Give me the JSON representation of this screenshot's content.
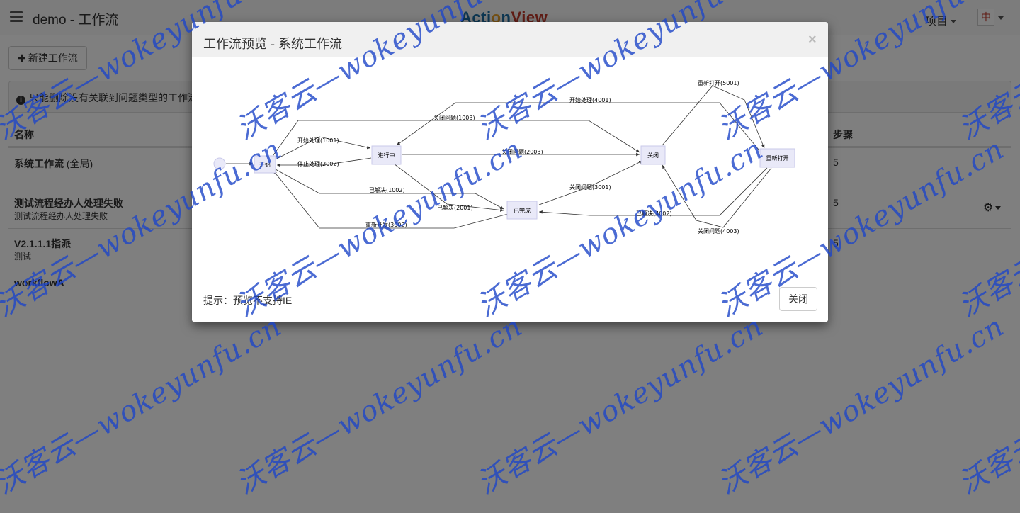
{
  "app": {
    "page_title": "demo - 工作流",
    "brand": {
      "a": "Acti",
      "o": "o",
      "n": "n",
      "v": "View"
    },
    "project_menu": "项目",
    "avatar_char": "中"
  },
  "toolbar": {
    "new_workflow": "新建工作流"
  },
  "alert": {
    "text": "只能删除没有关联到问题类型的工作流"
  },
  "table": {
    "headers": {
      "name": "名称",
      "steps": "步骤"
    },
    "rows": [
      {
        "name": "系统工作流",
        "scope": " (全局)",
        "desc": "",
        "steps": "5"
      },
      {
        "name": "测试流程经办人处理失败",
        "scope": "",
        "desc": "测试流程经办人处理失败",
        "steps": "5"
      },
      {
        "name": "V2.1.1.1指派",
        "scope": "",
        "desc": "测试",
        "steps": "5"
      },
      {
        "name": "workflowA",
        "scope": "",
        "desc": "",
        "steps": ""
      }
    ]
  },
  "modal": {
    "title": "工作流预览 - 系统工作流",
    "close_symbol": "×",
    "hint": "提示：预览不支持IE",
    "close_button": "关闭",
    "diagram": {
      "nodes": {
        "start": "开始",
        "in_progress": "进行中",
        "closed": "关闭",
        "reopened": "重新打开",
        "resolved": "已完成"
      },
      "edges": {
        "e1001": "开始处理(1001)",
        "e2002": "停止处理(2002)",
        "e1003": "关闭问题(1003)",
        "e4001": "开始处理(4001)",
        "e5001": "重新打开(5001)",
        "e2003": "关闭问题(2003)",
        "e1002": "已解决(1002)",
        "e2001": "已解决(2001)",
        "e3001": "关闭问题(3001)",
        "e4002": "已解决(4002)",
        "e3002": "重新开发(3002)",
        "e4003": "关闭问题(4003)"
      }
    }
  },
  "watermark": {
    "text": "沃客云—wokeyunfu.cn"
  },
  "colors": {
    "brand_blue": "#1d6fa5",
    "brand_orange": "#e8a12b",
    "brand_red": "#c0392b",
    "node_fill": "#e9e9f8",
    "watermark": "#1e46c8"
  }
}
